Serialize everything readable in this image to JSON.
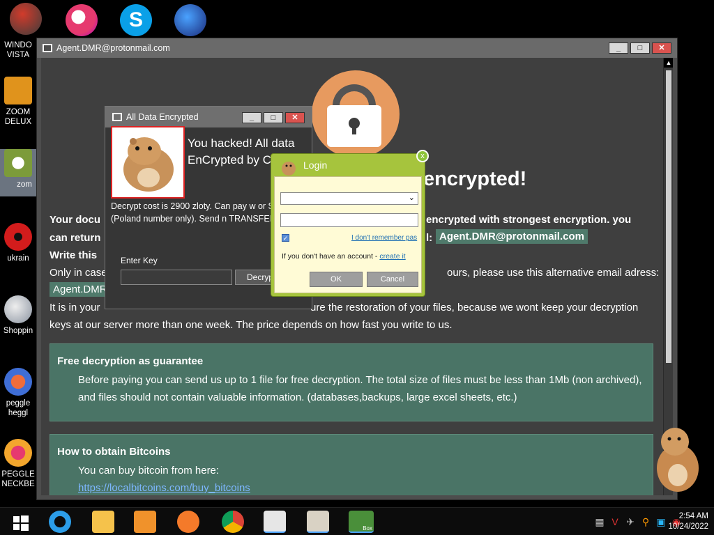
{
  "desktop": {
    "icons": [
      {
        "label": "WINDO VISTA",
        "color": "#d23b2b"
      },
      {
        "label": "ZOOM DELUX",
        "color": "#e0931c"
      },
      {
        "label": "zom",
        "color": "#ffffff"
      },
      {
        "label": "ukrain",
        "color": "#d31c1c"
      },
      {
        "label": "Shoppin",
        "color": "#b7bec8"
      },
      {
        "label": "peggle heggl",
        "color": "#3f6ed6"
      },
      {
        "label": "PEGGLE NECKBE",
        "color": "#f3a62d"
      }
    ],
    "top_icons": [
      "peggle-icon",
      "skype-icon",
      "globe-icon"
    ]
  },
  "main_window": {
    "title": "Agent.DMR@protonmail.com",
    "headline": "encrypted!",
    "line1_left": "Your docu",
    "line1_right": "encrypted with strongest encryption. you",
    "line2_left": "can return",
    "line2_mid": "l:",
    "email": "Agent.DMR@protonmail.com",
    "line3": "Write this",
    "line4_left": "Only in case",
    "line4_right": "ours, please use this alternative email adress:",
    "alt_email_partial": "Agent.DMR",
    "line5_left": "It is in your",
    "line5_right": "ure the restoration of your files, because we wont keep your decryption",
    "line6": "keys at our server more than one week. The price depends on how fast you write to us.",
    "panel1": {
      "title": "Free decryption as guarantee",
      "body": "Before paying you can send us up to 1 file for free decryption. The total size of files must be less than 1Mb (non archived), and files should not contain valuable information. (databases,backups, large excel sheets, etc.)"
    },
    "panel2": {
      "title": "How to obtain Bitcoins",
      "body": "You can buy bitcoin from here:",
      "link": "https://localbitcoins.com/buy_bitcoins"
    }
  },
  "ransom_window": {
    "title": "All Data Encrypted",
    "heading_line1": "You hacked! All data",
    "heading_line2": "EnCrypted by C",
    "message": "Decrypt cost is 2900 zloty. Can pay w or SMS (Poland number only). Send n TRANSFER to 77038",
    "enter_key_label": "Enter Key",
    "key_value": "",
    "decrypt_button": "Decryp"
  },
  "login_dialog": {
    "title": "Login",
    "close_label": "x",
    "dropdown_value": "",
    "password_value": "",
    "remember_checked": true,
    "forgot_link": "I don't remember pas",
    "no_account_text": "If you don't have an account -",
    "create_link": "create it",
    "ok_label": "OK",
    "cancel_label": "Cancel"
  },
  "taskbar": {
    "apps": [
      "start-icon",
      "ie-icon",
      "explorer-icon",
      "media-player-icon",
      "uc-browser-icon",
      "chrome-icon",
      "document-icon",
      "watch-icon",
      "hamster-box-icon"
    ],
    "box_label": "Box",
    "time": "2:54 AM",
    "date": "10/24/2022"
  },
  "colors": {
    "window_body": "#3f3f3f",
    "panel": "#4a7466",
    "lock_circle": "#e79a5f",
    "login_green": "#a6c43d"
  }
}
